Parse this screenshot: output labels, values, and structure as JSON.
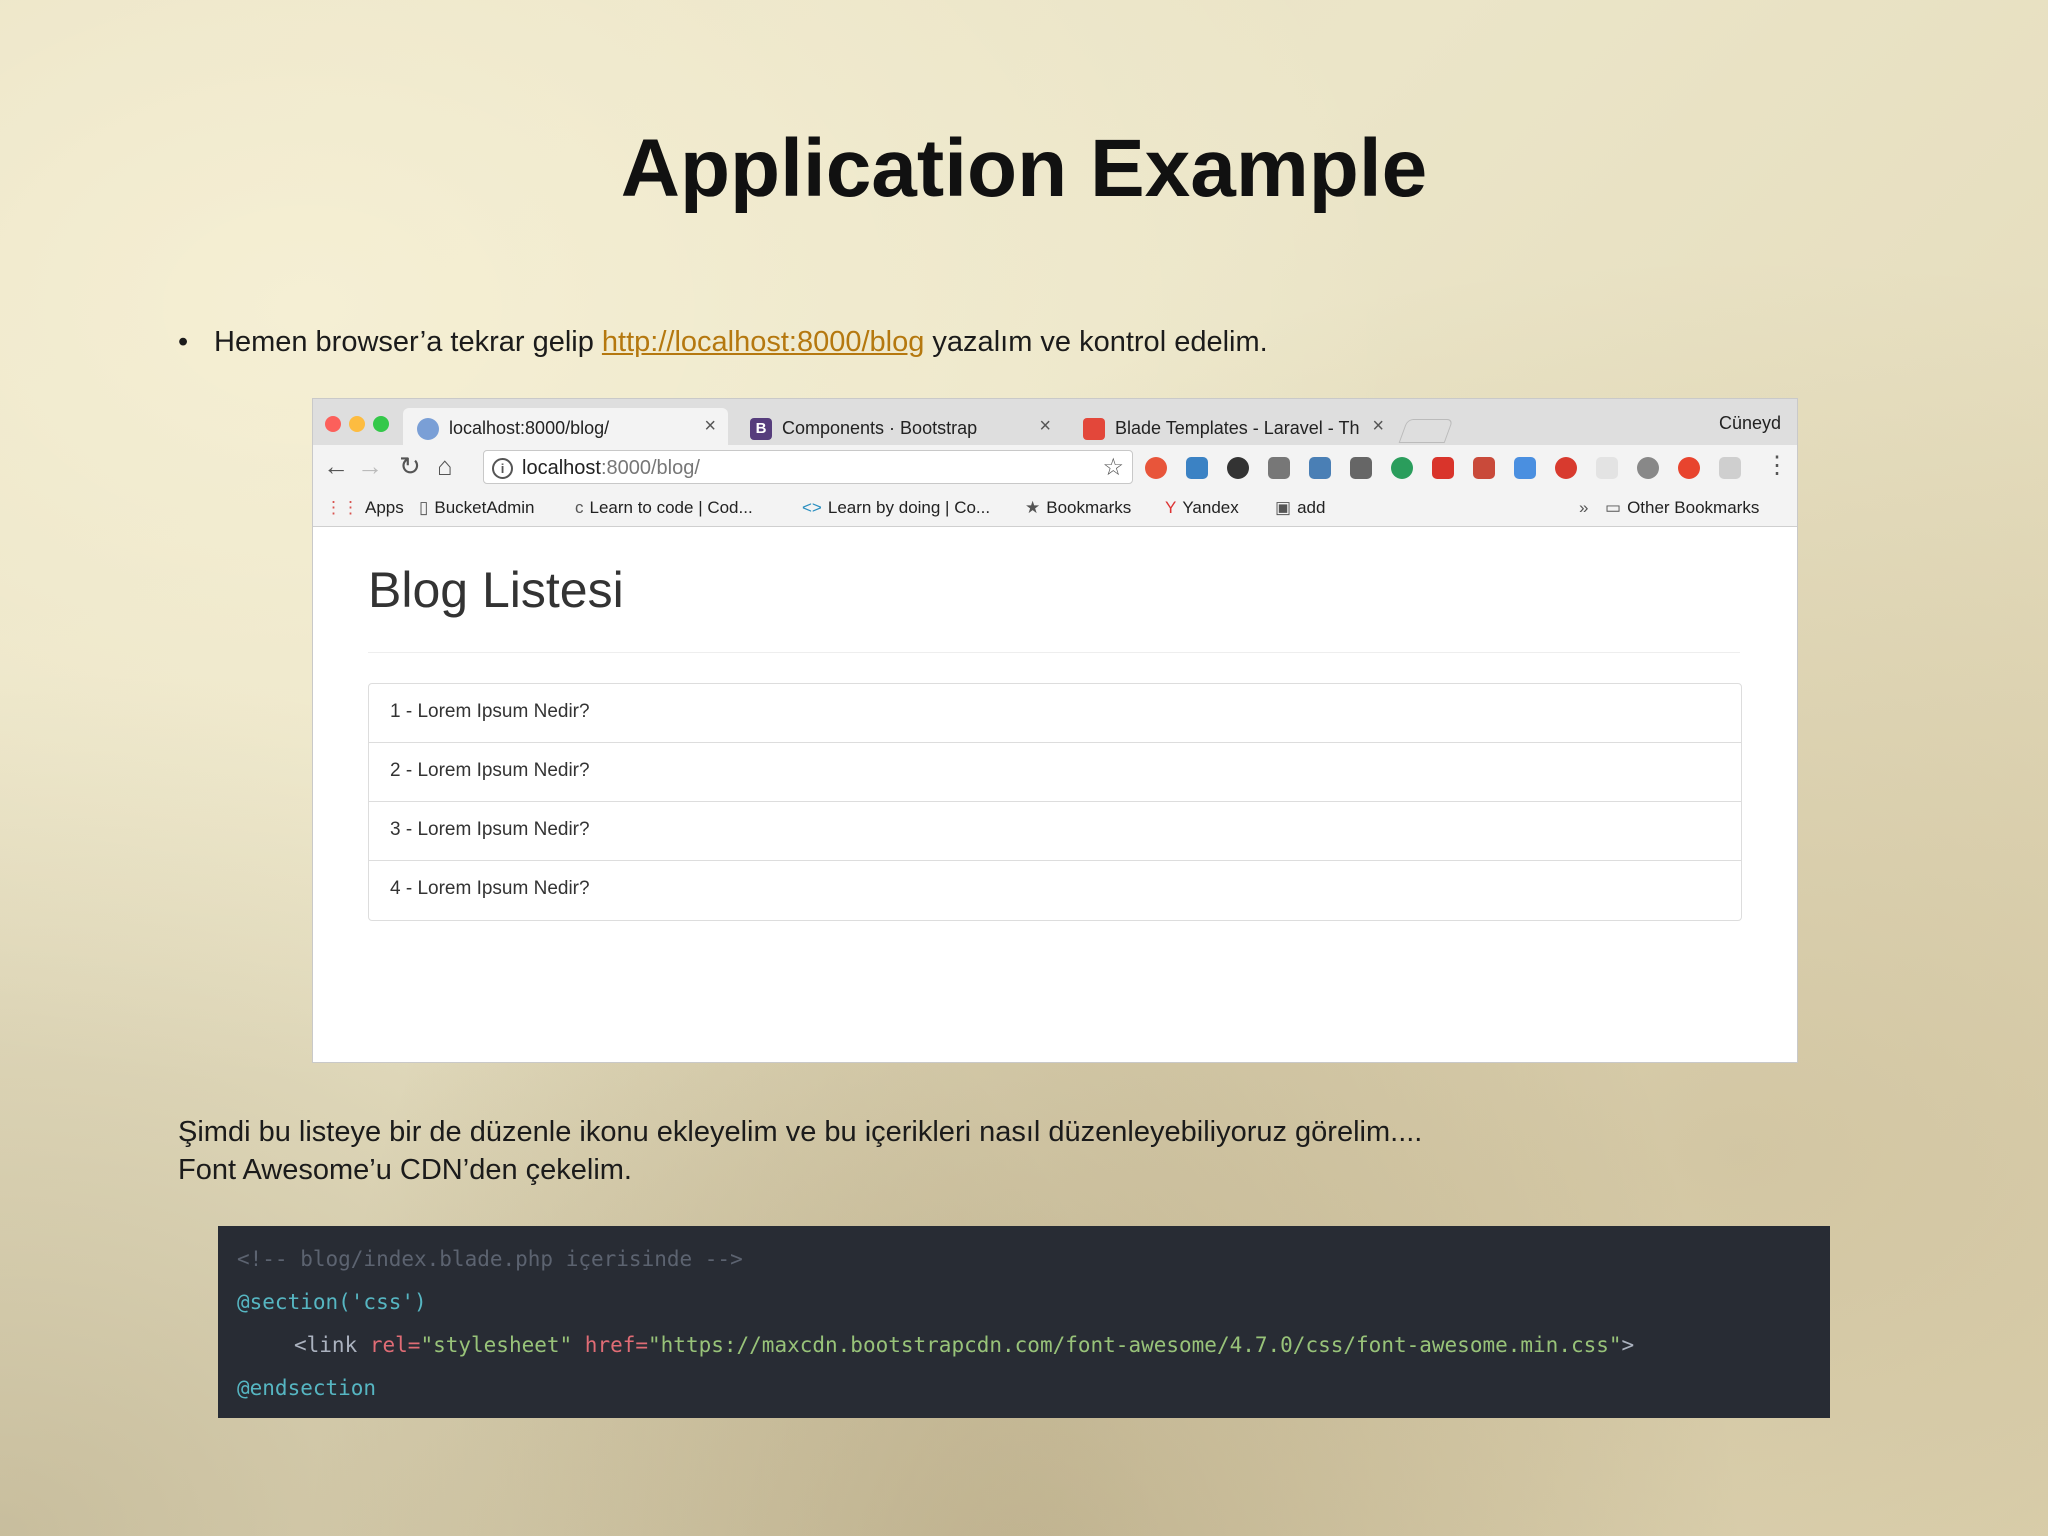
{
  "slide": {
    "title": "Application Example",
    "bullet_prefix": "Hemen browser’a tekrar gelip ",
    "bullet_link": "http://localhost:8000/blog",
    "bullet_suffix": " yazalım ve kontrol edelim.",
    "paragraph_line1": "Şimdi bu listeye bir de düzenle ikonu ekleyelim ve bu içerikleri nasıl düzenleyebiliyoruz görelim....",
    "paragraph_line2": "Font Awesome’u CDN’den çekelim."
  },
  "browser": {
    "tabs": [
      {
        "label": "localhost:8000/blog/",
        "icon": "globe-icon"
      },
      {
        "label": "Components · Bootstrap",
        "icon": "bootstrap-icon"
      },
      {
        "label": "Blade Templates - Laravel - Th",
        "icon": "laravel-icon"
      }
    ],
    "user": "Cüneyd",
    "address": {
      "host": "localhost",
      "path": ":8000/blog/"
    },
    "bookmarks": [
      "Apps",
      "BucketAdmin",
      "Learn to code | Cod...",
      "Learn by doing | Co...",
      "Bookmarks",
      "Yandex",
      "add"
    ],
    "bookmarks_overflow": "»",
    "other_bookmarks": "Other Bookmarks",
    "colors": {
      "close": "#fc605b",
      "minimize": "#fdbc40",
      "maximize": "#34c84a"
    }
  },
  "page": {
    "heading": "Blog Listesi",
    "items": [
      "1 - Lorem Ipsum Nedir?",
      "2 - Lorem Ipsum Nedir?",
      "3 - Lorem Ipsum Nedir?",
      "4 - Lorem Ipsum Nedir?"
    ]
  },
  "code": {
    "comment": "<!-- blog/index.blade.php içerisinde -->",
    "section_open": "@section('css')",
    "link_open": "<link ",
    "rel_attr": "rel=",
    "rel_value": "\"stylesheet\"",
    "href_attr": " href=",
    "href_value": "\"https://maxcdn.bootstrapcdn.com/font-awesome/4.7.0/css/font-awesome.min.css\"",
    "link_close": ">",
    "section_close": "@endsection"
  }
}
